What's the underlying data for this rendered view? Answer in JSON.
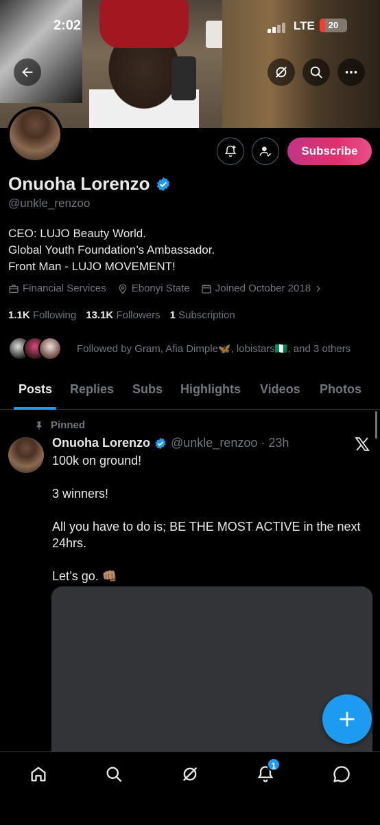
{
  "status_bar": {
    "time": "2:02",
    "network": "LTE",
    "battery": "20"
  },
  "profile": {
    "name": "Onuoha Lorenzo",
    "handle": "@unkle_renzoo",
    "subscribe_label": "Subscribe",
    "bio": [
      "CEO: LUJO Beauty World.",
      "Global Youth Foundation’s Ambassador.",
      "Front Man - LUJO MOVEMENT!"
    ],
    "category": "Financial Services",
    "location": "Ebonyi State",
    "joined": "Joined October 2018",
    "following_count": "1.1K",
    "following_label": "Following",
    "followers_count": "13.1K",
    "followers_label": "Followers",
    "subscription_count": "1",
    "subscription_label": "Subscription",
    "followed_by": "Followed by Gram, Afia Dimple🦋, lobistars🇳🇬, and 3 others"
  },
  "tabs": [
    "Posts",
    "Replies",
    "Subs",
    "Highlights",
    "Videos",
    "Photos"
  ],
  "post": {
    "pinned_label": "Pinned",
    "author": "Onuoha Lorenzo",
    "handle_time": "@unkle_renzoo · 23h",
    "paragraphs": [
      "100k on ground!",
      "3 winners!",
      "All you have to do is; BE THE MOST ACTIVE in the next 24hrs.",
      "Let’s go. 👊🏽"
    ]
  },
  "nav": {
    "notifications_badge": "1"
  },
  "colors": {
    "accent": "#1d9bf0",
    "subscribe_gradient_start": "#c13584",
    "subscribe_gradient_end": "#e8508a"
  },
  "icons": {
    "back": "arrow-left-icon",
    "grok": "grok-icon",
    "search": "search-icon",
    "more": "more-icon",
    "notify": "bell-plus-icon",
    "follow": "person-check-icon",
    "category": "briefcase-icon",
    "location": "location-pin-icon",
    "calendar": "calendar-icon",
    "pin": "pin-icon",
    "x": "x-logo-icon",
    "compose": "plus-icon",
    "home": "home-icon",
    "notifications": "bell-icon",
    "messages": "message-icon"
  }
}
